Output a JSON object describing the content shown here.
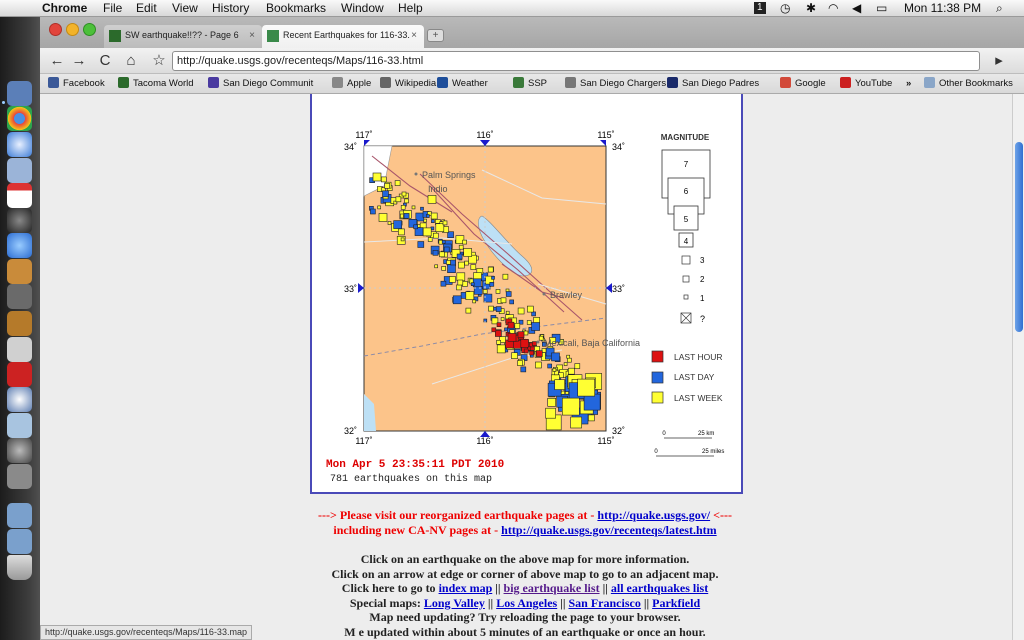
{
  "menubar": {
    "app": "Chrome",
    "items": [
      "File",
      "Edit",
      "View",
      "History",
      "Bookmarks",
      "Window",
      "Help"
    ],
    "badge": "1",
    "clock": "Mon 11:38 PM"
  },
  "tabs": [
    {
      "title": "SW earthquake!!?? - Page 6",
      "close": "×"
    },
    {
      "title": "Recent Earthquakes for 116-33.",
      "close": "×"
    }
  ],
  "address": {
    "url": "http://quake.usgs.gov/recenteqs/Maps/116-33.html"
  },
  "bookmarks": {
    "items": [
      {
        "label": "Facebook",
        "color": "#3b5998"
      },
      {
        "label": "Tacoma World",
        "color": "#2b6a2b"
      },
      {
        "label": "San Diego Communit",
        "color": "#4a3aa0"
      },
      {
        "label": "Apple",
        "color": "#888888"
      },
      {
        "label": "Wikipedia",
        "color": "#666666"
      },
      {
        "label": "Weather",
        "color": "#1e4e9a"
      },
      {
        "label": "SSP",
        "color": "#3a7a3a"
      },
      {
        "label": "San Diego Chargers",
        "color": "#777777"
      },
      {
        "label": "San Diego Padres",
        "color": "#1a2a6a"
      },
      {
        "label": "Google",
        "color": "#d24a3a"
      },
      {
        "label": "YouTube",
        "color": "#cc2020"
      }
    ],
    "more": "»",
    "other": "Other Bookmarks"
  },
  "map": {
    "lon_labels": [
      "117˚",
      "116˚",
      "115˚"
    ],
    "lat_labels": [
      "34˚",
      "33˚",
      "32˚"
    ],
    "places": [
      "Palm Springs",
      "Indio",
      "Brawley",
      "Mexicali, Baja California"
    ],
    "timestamp": "Mon Apr  5 23:35:11 PDT 2010",
    "count_text": "781 earthquakes on this map",
    "legend": {
      "title": "MAGNITUDE",
      "mags": [
        "7",
        "6",
        "5",
        "4",
        "3",
        "2",
        "1",
        "?"
      ],
      "last_hour": "LAST HOUR",
      "last_day": "LAST DAY",
      "last_week": "LAST WEEK",
      "km": "25 km",
      "miles": "25 miles",
      "zero": "0",
      "c_hour": "#dd1111",
      "c_day": "#2266dd",
      "c_week": "#ffff33"
    }
  },
  "notice": {
    "line1_pre": "---> Please visit our reorganized earthquake pages at - ",
    "line1_link": "http://quake.usgs.gov/",
    "line1_post": " <---",
    "line2_pre": "including new CA-NV pages at - ",
    "line2_link": "http://quake.usgs.gov/recenteqs/latest.htm"
  },
  "info": {
    "l1": "Click on an earthquake on the above map for more information.",
    "l2": "Click on an arrow at edge or corner of above map to go to an adjacent map.",
    "l3_pre": "Click here to go to ",
    "l3_a": "index map",
    "l3_s1": " || ",
    "l3_b": "big earthquake list",
    "l3_s2": " || ",
    "l3_c": "all earthquakes list",
    "l4_pre": "Special maps: ",
    "l4_a": "Long Valley",
    "l4_s1": " || ",
    "l4_b": "Los Angeles",
    "l4_s2": " || ",
    "l4_c": "San Francisco",
    "l4_s3": " || ",
    "l4_d": "Parkfield",
    "l5": "Map need updating? Try reloading the page to your browser.",
    "l6": "M       e updated within about 5 minutes of an earthquake or once an hour."
  },
  "status_url": "http://quake.usgs.gov/recenteqs/Maps/116-33.map"
}
